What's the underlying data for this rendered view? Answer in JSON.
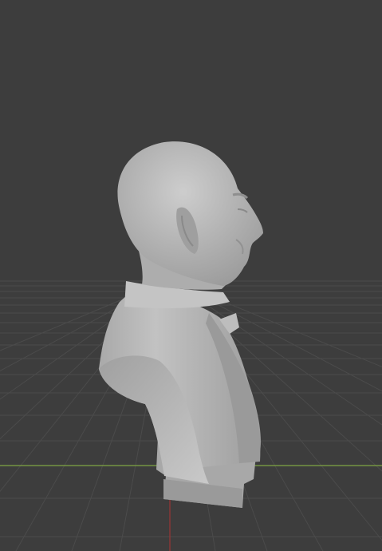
{
  "app": "3D viewport",
  "viewport": {
    "background": "#3d3d3d",
    "grid_color": "#4a4a4a",
    "x_axis_color": "#8ab34a",
    "y_axis_color": "#a03a3a",
    "model_color": "#b8b8b8",
    "model": "sculpted-bust-side-profile"
  }
}
